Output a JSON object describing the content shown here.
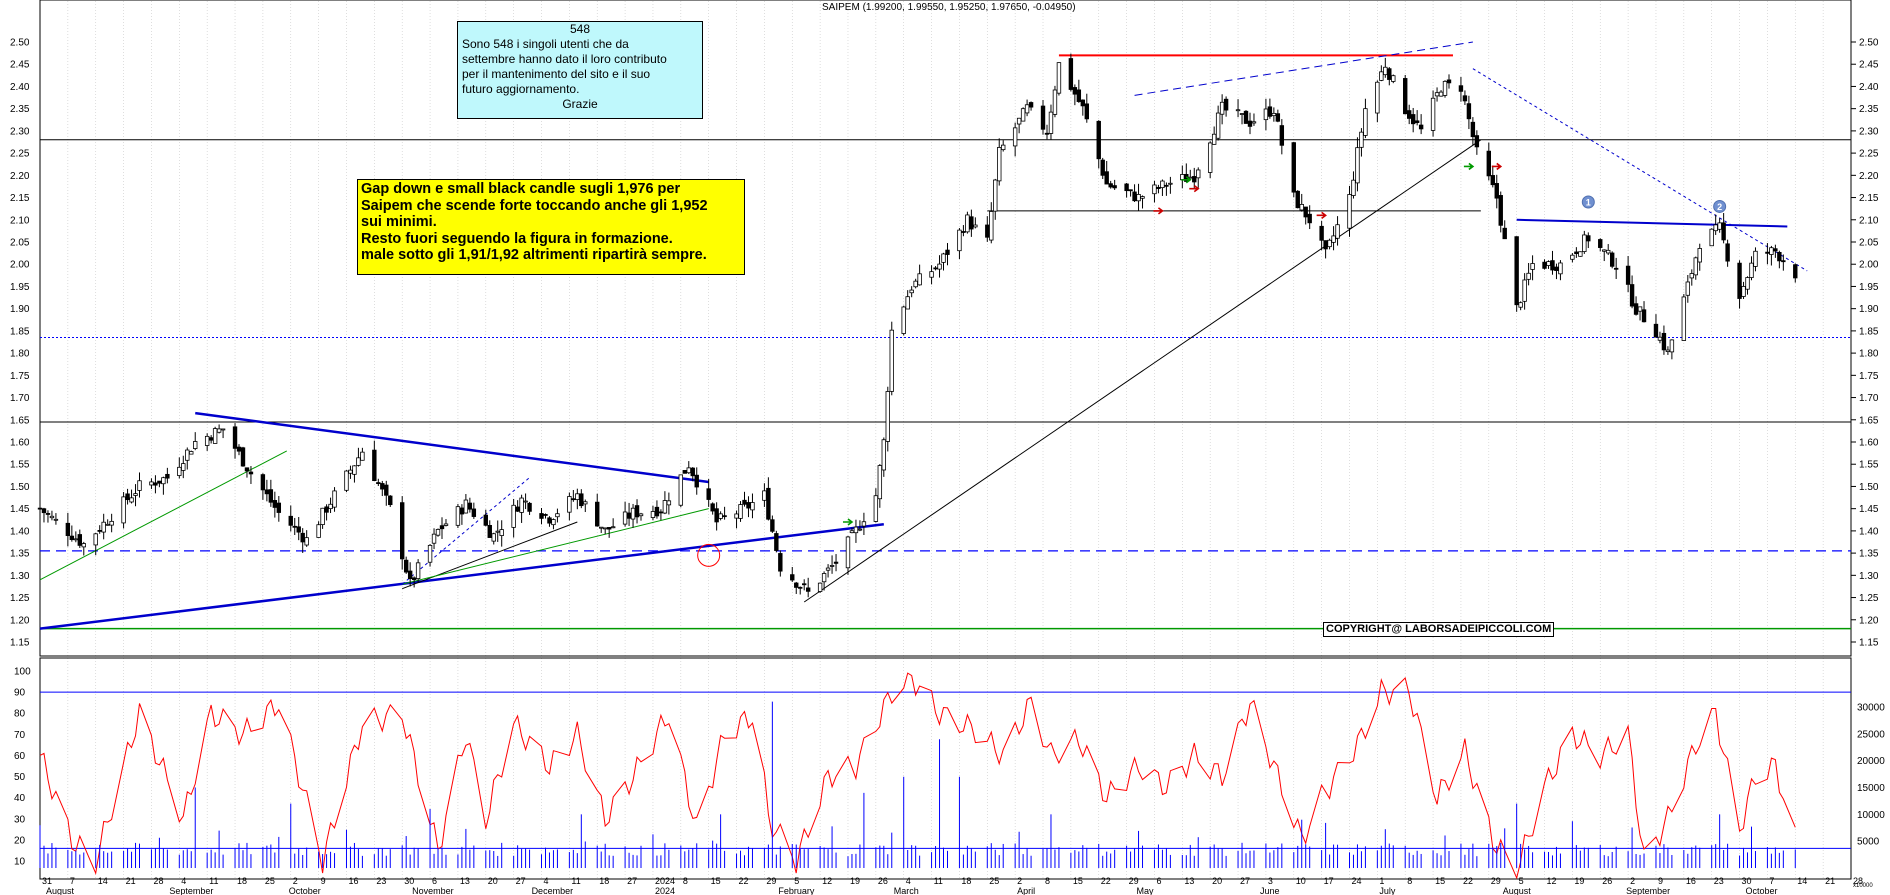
{
  "header": "SAIPEM (1.99200, 1.99550, 1.95250, 1.97650, -0.04950)",
  "info_box": {
    "title": "548",
    "lines": [
      "Sono 548 i singoli utenti che da",
      "settembre hanno dato il loro contributo",
      "per il mantenimento  del sito e il suo",
      "futuro aggiornamento."
    ],
    "footer": "Grazie"
  },
  "comment_box": {
    "lines": [
      "Gap down e small black candle sugli 1,976 per",
      "Saipem che scende forte toccando anche gli 1,952",
      "sui minimi.",
      "Resto fuori seguendo la figura in formazione.",
      "male sotto gli 1,91/1,92 altrimenti ripartirà sempre."
    ]
  },
  "copyright": "COPYRIGHT@ LABORSADEIPICCOLI.COM",
  "colors": {
    "trend_blue": "#0000cc",
    "resistance_red": "#ff0000",
    "oscillator": "#ff0000",
    "volume": "#0000ff",
    "support_green": "#009900"
  },
  "chart_data": [
    {
      "type": "candlestick",
      "title": "SAIPEM",
      "ylim": [
        1.1,
        2.52
      ],
      "y_ticks": [
        "2.50",
        "2.45",
        "2.40",
        "2.35",
        "2.30",
        "2.25",
        "2.20",
        "2.15",
        "2.10",
        "2.05",
        "2.00",
        "1.95",
        "1.90",
        "1.85",
        "1.80",
        "1.75",
        "1.70",
        "1.65",
        "1.60",
        "1.55",
        "1.50",
        "1.45",
        "1.40",
        "1.35",
        "1.30",
        "1.25",
        "1.20",
        "1.15"
      ],
      "x_day_labels": [
        "31",
        "7",
        "14",
        "21",
        "28",
        "4",
        "11",
        "18",
        "25",
        "2",
        "9",
        "16",
        "23",
        "30",
        "6",
        "13",
        "20",
        "27",
        "4",
        "11",
        "18",
        "27",
        "2024",
        "8",
        "15",
        "22",
        "29",
        "5",
        "12",
        "19",
        "26",
        "4",
        "11",
        "18",
        "25",
        "2",
        "8",
        "15",
        "22",
        "29",
        "6",
        "13",
        "20",
        "27",
        "3",
        "10",
        "17",
        "24",
        "1",
        "8",
        "15",
        "22",
        "29",
        "5",
        "12",
        "19",
        "26",
        "2",
        "9",
        "16",
        "23",
        "30",
        "7",
        "14",
        "21",
        "28"
      ],
      "x_month_labels": [
        "August",
        "September",
        "October",
        "November",
        "December",
        "2024",
        "February",
        "March",
        "April",
        "May",
        "June",
        "July",
        "August",
        "September",
        "October"
      ],
      "horizontal_levels": [
        2.28,
        1.835,
        1.645,
        1.355,
        1.18
      ],
      "annotations": [
        "1",
        "2"
      ],
      "anchors": [
        [
          "2023-07-31",
          1.45
        ],
        [
          "2023-08-11",
          1.37
        ],
        [
          "2023-08-25",
          1.5
        ],
        [
          "2023-09-01",
          1.52
        ],
        [
          "2023-09-08",
          1.6
        ],
        [
          "2023-09-15",
          1.63
        ],
        [
          "2023-09-22",
          1.53
        ],
        [
          "2023-09-29",
          1.44
        ],
        [
          "2023-10-06",
          1.38
        ],
        [
          "2023-10-13",
          1.48
        ],
        [
          "2023-10-20",
          1.58
        ],
        [
          "2023-10-27",
          1.45
        ],
        [
          "2023-11-01",
          1.28
        ],
        [
          "2023-11-08",
          1.4
        ],
        [
          "2023-11-15",
          1.46
        ],
        [
          "2023-11-22",
          1.39
        ],
        [
          "2023-11-29",
          1.47
        ],
        [
          "2023-12-06",
          1.43
        ],
        [
          "2023-12-13",
          1.48
        ],
        [
          "2023-12-20",
          1.4
        ],
        [
          "2023-12-27",
          1.44
        ],
        [
          "2024-01-03",
          1.45
        ],
        [
          "2024-01-10",
          1.55
        ],
        [
          "2024-01-17",
          1.42
        ],
        [
          "2024-01-24",
          1.45
        ],
        [
          "2024-01-29",
          1.48
        ],
        [
          "2024-02-02",
          1.32
        ],
        [
          "2024-02-09",
          1.26
        ],
        [
          "2024-02-16",
          1.33
        ],
        [
          "2024-02-21",
          1.4
        ],
        [
          "2024-02-26",
          1.48
        ],
        [
          "2024-02-28",
          1.6
        ],
        [
          "2024-03-01",
          1.85
        ],
        [
          "2024-03-06",
          1.95
        ],
        [
          "2024-03-13",
          2.0
        ],
        [
          "2024-03-20",
          2.1
        ],
        [
          "2024-03-25",
          2.05
        ],
        [
          "2024-03-28",
          2.25
        ],
        [
          "2024-04-04",
          2.35
        ],
        [
          "2024-04-09",
          2.3
        ],
        [
          "2024-04-12",
          2.45
        ],
        [
          "2024-04-18",
          2.35
        ],
        [
          "2024-04-24",
          2.18
        ],
        [
          "2024-05-02",
          2.15
        ],
        [
          "2024-05-09",
          2.18
        ],
        [
          "2024-05-16",
          2.2
        ],
        [
          "2024-05-23",
          2.35
        ],
        [
          "2024-05-30",
          2.32
        ],
        [
          "2024-06-05",
          2.35
        ],
        [
          "2024-06-10",
          2.15
        ],
        [
          "2024-06-14",
          2.1
        ],
        [
          "2024-06-18",
          2.02
        ],
        [
          "2024-06-24",
          2.15
        ],
        [
          "2024-06-28",
          2.35
        ],
        [
          "2024-07-03",
          2.45
        ],
        [
          "2024-07-08",
          2.35
        ],
        [
          "2024-07-12",
          2.3
        ],
        [
          "2024-07-17",
          2.4
        ],
        [
          "2024-07-22",
          2.4
        ],
        [
          "2024-07-26",
          2.25
        ],
        [
          "2024-07-31",
          2.15
        ],
        [
          "2024-08-02",
          2.05
        ],
        [
          "2024-08-05",
          1.9
        ],
        [
          "2024-08-09",
          2.0
        ],
        [
          "2024-08-16",
          2.0
        ],
        [
          "2024-08-23",
          2.06
        ],
        [
          "2024-08-30",
          2.0
        ],
        [
          "2024-09-04",
          1.9
        ],
        [
          "2024-09-09",
          1.85
        ],
        [
          "2024-09-12",
          1.8
        ],
        [
          "2024-09-17",
          1.95
        ],
        [
          "2024-09-20",
          2.05
        ],
        [
          "2024-09-25",
          2.08
        ],
        [
          "2024-09-30",
          1.93
        ],
        [
          "2024-10-04",
          2.02
        ],
        [
          "2024-10-09",
          2.03
        ],
        [
          "2024-10-14",
          1.98
        ]
      ]
    },
    {
      "type": "line",
      "name": "oscillator",
      "ylim": [
        0,
        100
      ],
      "y_ticks": [
        "100",
        "90",
        "80",
        "70",
        "60",
        "50",
        "40",
        "30",
        "20",
        "10"
      ],
      "levels": [
        90,
        16
      ],
      "anchors": [
        [
          "2023-07-31",
          60
        ],
        [
          "2023-08-08",
          20
        ],
        [
          "2023-08-14",
          10
        ],
        [
          "2023-08-25",
          80
        ],
        [
          "2023-09-05",
          30
        ],
        [
          "2023-09-12",
          80
        ],
        [
          "2023-09-20",
          70
        ],
        [
          "2023-09-29",
          85
        ],
        [
          "2023-10-10",
          10
        ],
        [
          "2023-10-20",
          75
        ],
        [
          "2023-10-30",
          80
        ],
        [
          "2023-11-08",
          15
        ],
        [
          "2023-11-15",
          70
        ],
        [
          "2023-11-20",
          30
        ],
        [
          "2023-11-27",
          75
        ],
        [
          "2023-12-06",
          55
        ],
        [
          "2023-12-13",
          70
        ],
        [
          "2023-12-20",
          30
        ],
        [
          "2023-12-27",
          50
        ],
        [
          "2024-01-05",
          80
        ],
        [
          "2024-01-12",
          25
        ],
        [
          "2024-01-19",
          70
        ],
        [
          "2024-01-27",
          80
        ],
        [
          "2024-01-30",
          30
        ],
        [
          "2024-02-06",
          10
        ],
        [
          "2024-02-14",
          50
        ],
        [
          "2024-02-21",
          55
        ],
        [
          "2024-03-01",
          90
        ],
        [
          "2024-03-06",
          97
        ],
        [
          "2024-03-13",
          80
        ],
        [
          "2024-03-22",
          72
        ],
        [
          "2024-03-29",
          60
        ],
        [
          "2024-04-05",
          85
        ],
        [
          "2024-04-10",
          60
        ],
        [
          "2024-04-17",
          68
        ],
        [
          "2024-04-24",
          40
        ],
        [
          "2024-05-02",
          55
        ],
        [
          "2024-05-09",
          45
        ],
        [
          "2024-05-16",
          60
        ],
        [
          "2024-05-23",
          50
        ],
        [
          "2024-05-30",
          85
        ],
        [
          "2024-06-05",
          55
        ],
        [
          "2024-06-12",
          20
        ],
        [
          "2024-06-17",
          40
        ],
        [
          "2024-06-26",
          65
        ],
        [
          "2024-07-02",
          90
        ],
        [
          "2024-07-09",
          91
        ],
        [
          "2024-07-16",
          40
        ],
        [
          "2024-07-23",
          62
        ],
        [
          "2024-07-30",
          20
        ],
        [
          "2024-08-05",
          5
        ],
        [
          "2024-08-12",
          45
        ],
        [
          "2024-08-19",
          70
        ],
        [
          "2024-08-26",
          60
        ],
        [
          "2024-09-02",
          70
        ],
        [
          "2024-09-06",
          10
        ],
        [
          "2024-09-12",
          30
        ],
        [
          "2024-09-19",
          65
        ],
        [
          "2024-09-24",
          80
        ],
        [
          "2024-09-30",
          25
        ],
        [
          "2024-10-04",
          50
        ],
        [
          "2024-10-09",
          55
        ],
        [
          "2024-10-14",
          20
        ]
      ]
    },
    {
      "type": "bar",
      "name": "volume",
      "ylim": [
        0,
        32000
      ],
      "y_ticks": [
        "30000",
        "25000",
        "20000",
        "15000",
        "10000",
        "5000"
      ],
      "scale_label": "x10000",
      "spikes": [
        [
          "2023-09-08",
          15000
        ],
        [
          "2023-10-02",
          12000
        ],
        [
          "2023-11-06",
          11000
        ],
        [
          "2023-12-14",
          10000
        ],
        [
          "2024-01-18",
          10000
        ],
        [
          "2024-01-31",
          31000
        ],
        [
          "2024-02-23",
          14000
        ],
        [
          "2024-03-04",
          17000
        ],
        [
          "2024-03-13",
          24000
        ],
        [
          "2024-03-18",
          17000
        ],
        [
          "2024-04-10",
          10000
        ],
        [
          "2024-06-12",
          9000
        ],
        [
          "2024-08-05",
          12000
        ],
        [
          "2024-09-25",
          10000
        ]
      ],
      "base_level": 2200
    }
  ]
}
